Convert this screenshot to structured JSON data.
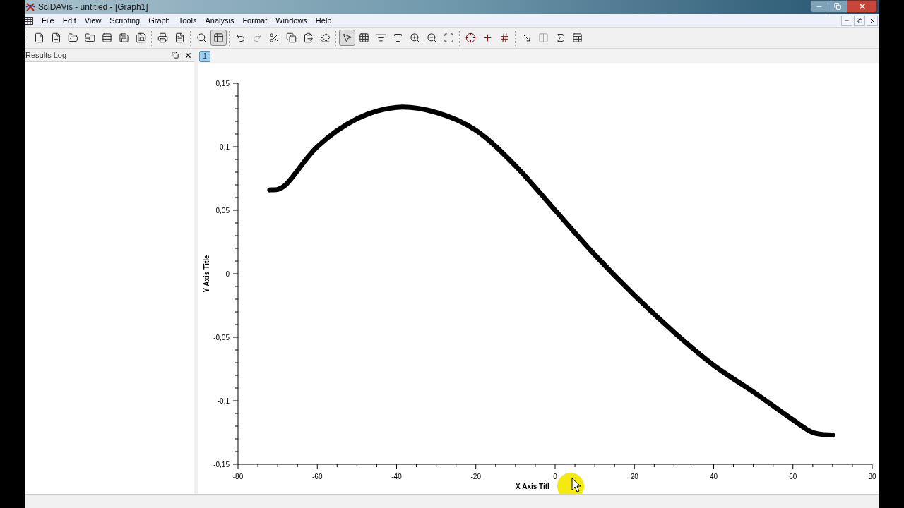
{
  "window": {
    "title": "SciDAVis - untitled - [Graph1]"
  },
  "menu": [
    "File",
    "Edit",
    "View",
    "Scripting",
    "Graph",
    "Tools",
    "Analysis",
    "Format",
    "Windows",
    "Help"
  ],
  "toolbar": [
    [
      {
        "pressed": false,
        "disabled": false
      },
      {
        "pressed": false,
        "disabled": false
      },
      {
        "pressed": false,
        "disabled": false
      },
      {
        "pressed": false,
        "disabled": false
      },
      {
        "pressed": false,
        "disabled": false
      },
      {
        "pressed": false,
        "disabled": false
      },
      {
        "pressed": false,
        "disabled": false
      }
    ],
    [
      {
        "pressed": false,
        "disabled": false
      },
      {
        "pressed": false,
        "disabled": false
      }
    ],
    [
      {
        "pressed": false,
        "disabled": false
      },
      {
        "pressed": true,
        "disabled": false
      }
    ],
    [
      {
        "pressed": false,
        "disabled": false
      },
      {
        "pressed": false,
        "disabled": true
      },
      {
        "pressed": false,
        "disabled": false
      },
      {
        "pressed": false,
        "disabled": false
      },
      {
        "pressed": false,
        "disabled": false
      },
      {
        "pressed": false,
        "disabled": false
      }
    ],
    [
      {
        "pressed": true,
        "disabled": false
      },
      {
        "pressed": false,
        "disabled": false
      },
      {
        "pressed": false,
        "disabled": false
      },
      {
        "pressed": false,
        "disabled": false
      },
      {
        "pressed": false,
        "disabled": false
      },
      {
        "pressed": false,
        "disabled": false
      },
      {
        "pressed": false,
        "disabled": false
      }
    ],
    [
      {
        "pressed": false,
        "disabled": false
      },
      {
        "pressed": false,
        "disabled": false
      },
      {
        "pressed": false,
        "disabled": false
      }
    ],
    [
      {
        "pressed": false,
        "disabled": false
      },
      {
        "pressed": false,
        "disabled": true
      },
      {
        "pressed": false,
        "disabled": false
      },
      {
        "pressed": false,
        "disabled": false
      }
    ]
  ],
  "results_log": {
    "title": "Results Log"
  },
  "graph": {
    "layer_tab": {
      "label": "1",
      "selected": true
    },
    "chart_data": {
      "type": "line",
      "xlabel": "X Axis Titl",
      "ylabel": "Y Axis Title",
      "x": [
        -72,
        -68,
        -60,
        -50,
        -40,
        -30,
        -20,
        -10,
        0,
        10,
        20,
        30,
        40,
        50,
        60,
        65,
        70
      ],
      "series": [
        {
          "color": "#000000",
          "values": [
            0.066,
            0.07,
            0.1,
            0.122,
            0.131,
            0.127,
            0.113,
            0.085,
            0.05,
            0.015,
            -0.017,
            -0.046,
            -0.072,
            -0.093,
            -0.115,
            -0.125,
            -0.127
          ]
        }
      ],
      "xlim": [
        -80,
        80
      ],
      "ylim": [
        -0.15,
        0.15
      ],
      "xticks": [
        -80,
        -60,
        -40,
        -20,
        0,
        20,
        40,
        60,
        80
      ],
      "yticks": [
        {
          "value": 0.15,
          "label": "0,15"
        },
        {
          "value": 0.1,
          "label": "0,1"
        },
        {
          "value": 0.05,
          "label": "0,05"
        },
        {
          "value": 0,
          "label": "0"
        },
        {
          "value": -0.05,
          "label": "-0,05"
        },
        {
          "value": -0.1,
          "label": "-0,1"
        },
        {
          "value": -0.15,
          "label": "-0,15"
        }
      ]
    }
  }
}
